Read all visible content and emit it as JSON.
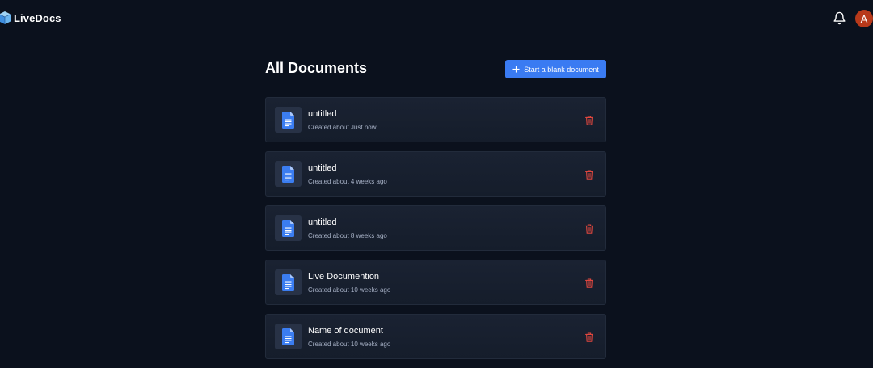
{
  "app": {
    "name": "LiveDocs",
    "logo_icon": "cube-logo-icon",
    "notification_icon": "bell-icon",
    "avatar_initial": "A",
    "avatar_color": "#b8391a"
  },
  "main": {
    "title": "All Documents",
    "new_button": {
      "label": "Start a blank document",
      "icon": "plus-icon",
      "color": "#3a7bf2"
    }
  },
  "documents": [
    {
      "title": "untitled",
      "meta": "Created about Just now",
      "icon": "document-icon",
      "action_icon": "trash-icon"
    },
    {
      "title": "untitled",
      "meta": "Created about 4 weeks ago",
      "icon": "document-icon",
      "action_icon": "trash-icon"
    },
    {
      "title": "untitled",
      "meta": "Created about 8 weeks ago",
      "icon": "document-icon",
      "action_icon": "trash-icon"
    },
    {
      "title": "Live Documention",
      "meta": "Created about 10 weeks ago",
      "icon": "document-icon",
      "action_icon": "trash-icon"
    },
    {
      "title": "Name of document",
      "meta": "Created about 10 weeks ago",
      "icon": "document-icon",
      "action_icon": "trash-icon"
    }
  ],
  "colors": {
    "background": "#0b111d",
    "card": "#1a2232",
    "doc_icon": "#3b7df1",
    "delete": "#e0473f",
    "muted_text": "#a7b1c6"
  }
}
